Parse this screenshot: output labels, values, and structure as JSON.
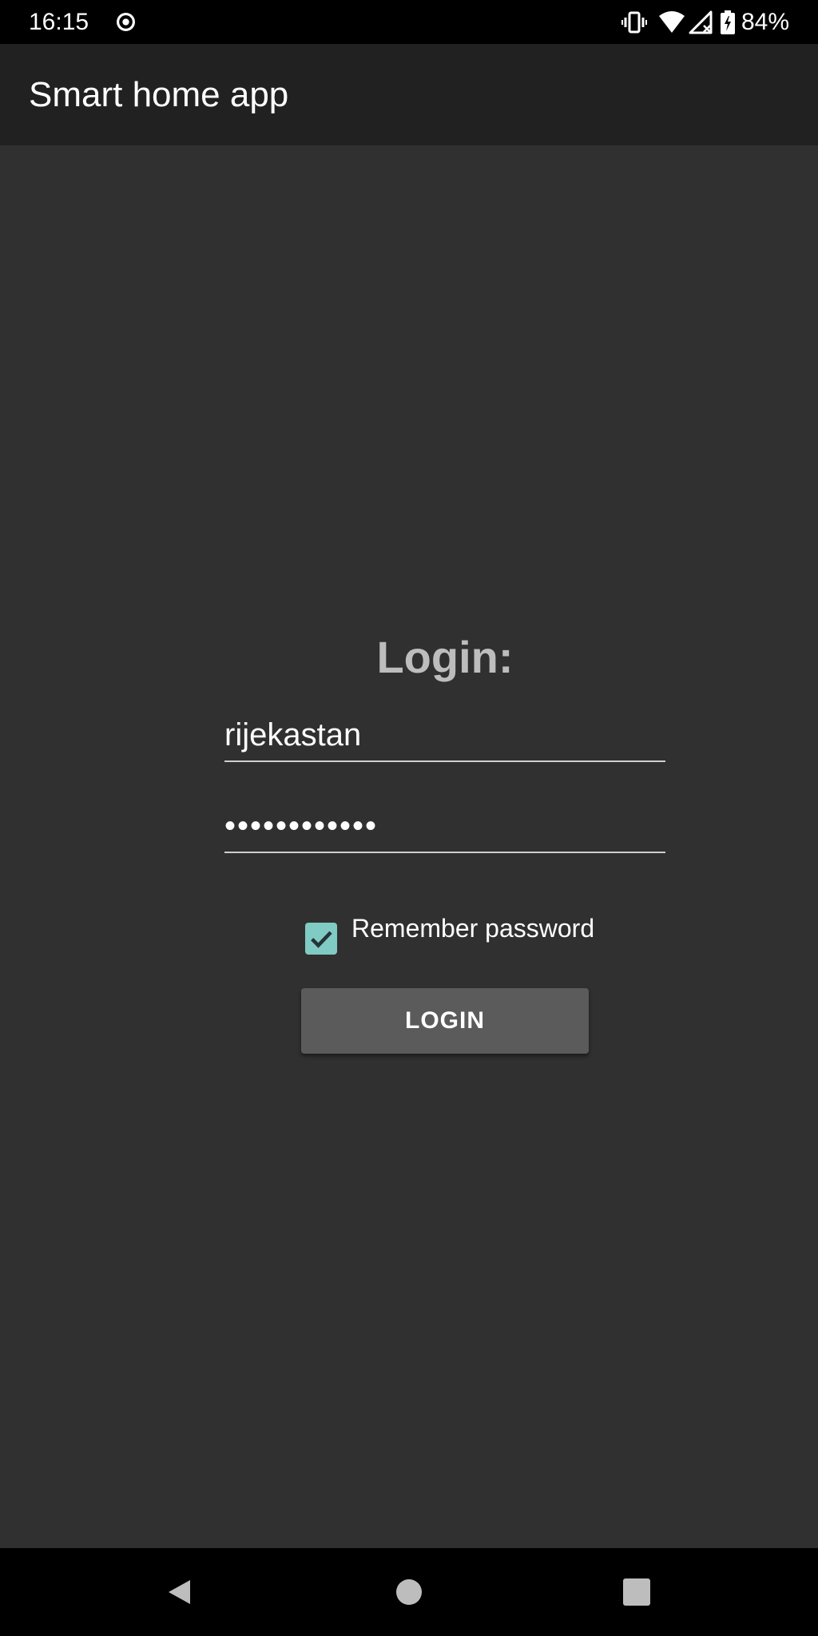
{
  "status_bar": {
    "time": "16:15",
    "battery": "84%",
    "icons": [
      "record-icon",
      "vibrate-icon",
      "wifi-icon",
      "signal-icon",
      "battery-charging-icon"
    ]
  },
  "app_bar": {
    "title": "Smart home app"
  },
  "login": {
    "heading": "Login:",
    "username_value": "rijekastan",
    "password_value": "••••••••••••",
    "remember_label": "Remember password",
    "remember_checked": true,
    "button_label": "LOGIN"
  },
  "nav_bar": {
    "icons": [
      "back-icon",
      "home-icon",
      "recents-icon"
    ]
  },
  "colors": {
    "background": "#303030",
    "app_bar": "#212121",
    "status_bar": "#000000",
    "accent": "#80cbc4",
    "button": "#5b5b5c",
    "heading": "#bdbdbd"
  }
}
